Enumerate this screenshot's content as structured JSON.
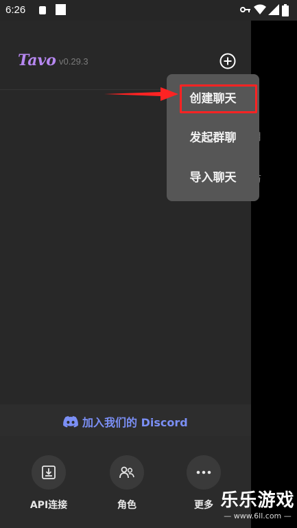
{
  "status_bar": {
    "time": "6:26",
    "icons": [
      "a-notification-icon",
      "square-notification-icon",
      "key-icon",
      "wifi-icon",
      "signal-icon",
      "battery-icon"
    ]
  },
  "drawer": {
    "logo": "Tavo",
    "version": "v0.29.3",
    "add_icon": "plus-circle-icon"
  },
  "popup_menu": {
    "items": [
      {
        "label": "创建聊天"
      },
      {
        "label": "发起群聊"
      },
      {
        "label": "导入聊天"
      }
    ]
  },
  "peek_text": [
    "用",
    "访"
  ],
  "discord": {
    "label": "加入我们的 Discord",
    "icon": "discord-icon"
  },
  "bottom_nav": [
    {
      "label": "API连接",
      "icon": "import-icon"
    },
    {
      "label": "角色",
      "icon": "people-icon"
    },
    {
      "label": "更多",
      "icon": "more-icon"
    }
  ],
  "watermark": {
    "main": "乐乐游戏",
    "sub": "— www.6ll.com —"
  },
  "colors": {
    "accent": "#b687f0",
    "discord": "#7b8ff5",
    "highlight": "#ff2323"
  }
}
